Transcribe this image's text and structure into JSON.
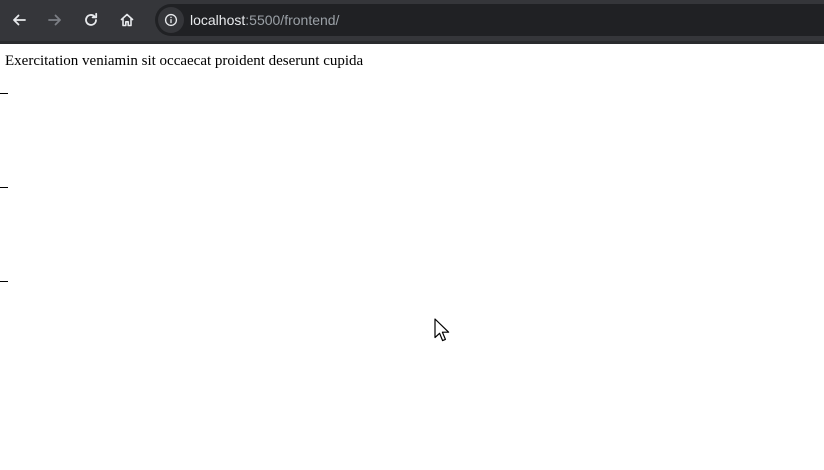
{
  "browser": {
    "url_host": "localhost",
    "url_rest": ":5500/frontend/",
    "icons": {
      "back": "arrow-left-icon",
      "forward": "arrow-right-icon",
      "reload": "reload-icon",
      "home": "home-icon",
      "site_info": "info-icon"
    },
    "colors": {
      "toolbar": "#35363a",
      "omnibox": "#202124",
      "url_host": "#e8eaed",
      "url_rest": "#9aa0a6"
    }
  },
  "page": {
    "text": "Exercitation veniamin sit occaecat proident deserunt cupida",
    "list_markers": [
      "–",
      "–",
      "–"
    ]
  }
}
